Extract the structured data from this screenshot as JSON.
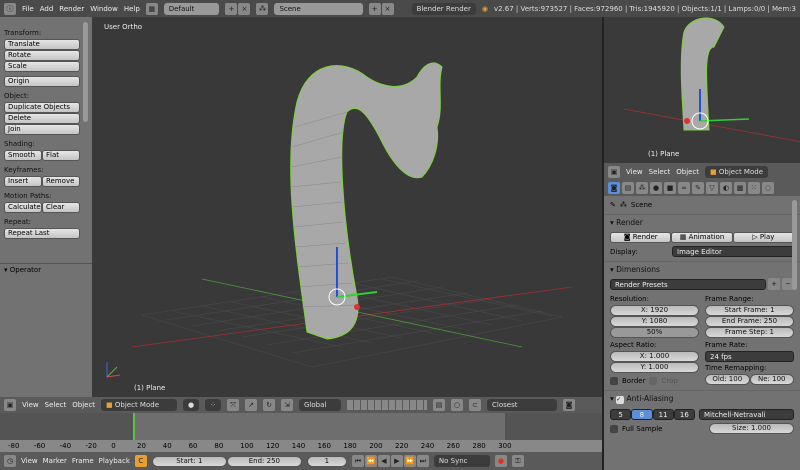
{
  "topbar": {
    "menus": [
      "File",
      "Add",
      "Render",
      "Window",
      "Help"
    ],
    "layout": "Default",
    "scene": "Scene",
    "engine": "Blender Render",
    "stats": "v2.67 | Verts:973527 | Faces:972960 | Tris:1945920 | Objects:1/1 | Lamps:0/0 | Mem:3"
  },
  "toolshelf": {
    "transform_label": "Transform:",
    "translate": "Translate",
    "rotate": "Rotate",
    "scale": "Scale",
    "origin": "Origin",
    "object_label": "Object:",
    "duplicate": "Duplicate Objects",
    "delete": "Delete",
    "join": "Join",
    "shading_label": "Shading:",
    "smooth": "Smooth",
    "flat": "Flat",
    "keyframes_label": "Keyframes:",
    "insert": "Insert",
    "remove": "Remove",
    "motion_label": "Motion Paths:",
    "calculate": "Calculate",
    "clear": "Clear",
    "repeat_label": "Repeat:",
    "repeat_last": "Repeat Last",
    "operator": "Operator"
  },
  "viewport": {
    "view_name": "User Ortho",
    "object_name": "(1) Plane"
  },
  "mini_viewport": {
    "object_name": "(1) Plane"
  },
  "view3d_header": {
    "menus": [
      "View",
      "Select",
      "Object"
    ],
    "mode": "Object Mode",
    "orientation": "Global",
    "snap": "Closest"
  },
  "props_header": {
    "menus": [
      "View",
      "Select",
      "Object"
    ],
    "mode": "Object Mode"
  },
  "properties": {
    "scene": "Scene",
    "render_section": "Render",
    "render_btn": "Render",
    "animation_btn": "Animation",
    "play_btn": "Play",
    "display_label": "Display:",
    "display_value": "Image Editor",
    "dimensions_section": "Dimensions",
    "presets": "Render Presets",
    "resolution_label": "Resolution:",
    "res_x": "X: 1920",
    "res_y": "Y: 1080",
    "res_pct": "50%",
    "frame_range_label": "Frame Range:",
    "start_frame": "Start Frame: 1",
    "end_frame": "End Frame: 250",
    "frame_step": "Frame Step: 1",
    "aspect_label": "Aspect Ratio:",
    "asp_x": "X: 1.000",
    "asp_y": "Y: 1.000",
    "frame_rate_label": "Frame Rate:",
    "fps": "24 fps",
    "remap_label": "Time Remapping:",
    "old": "Old: 100",
    "new": "Ne: 100",
    "border": "Border",
    "crop": "Crop",
    "aa_section": "Anti-Aliasing",
    "aa_samples": [
      "5",
      "8",
      "11",
      "16"
    ],
    "aa_selected": "8",
    "filter": "Mitchell-Netravali",
    "full_sample": "Full Sample",
    "size": "Size: 1.000"
  },
  "timeline": {
    "ticks": [
      "-80",
      "-60",
      "-40",
      "-20",
      "0",
      "20",
      "40",
      "60",
      "80",
      "100",
      "120",
      "140",
      "160",
      "180",
      "200",
      "220",
      "240",
      "260",
      "280",
      "300"
    ],
    "menus": [
      "View",
      "Marker",
      "Frame",
      "Playback"
    ],
    "start": "Start: 1",
    "end": "End: 250",
    "current": "1",
    "sync": "No Sync"
  },
  "colors": {
    "accent": "#5b8fd8",
    "current_frame": "#60c040",
    "selection_outline": "#7cd33a"
  }
}
